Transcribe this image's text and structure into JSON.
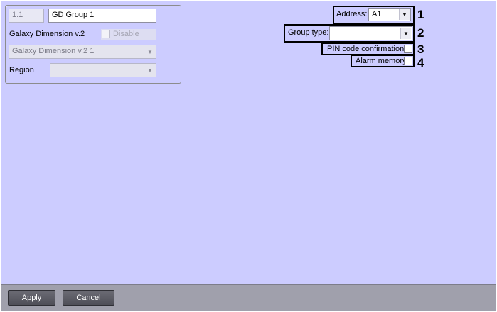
{
  "group": {
    "number": "1.1",
    "name": "GD Group 1",
    "parent_label": "Galaxy Dimension v.2",
    "disable_label": "Disable",
    "parent_select": "Galaxy Dimension v.2 1",
    "region_label": "Region",
    "region_value": ""
  },
  "settings": {
    "address_label": "Address:",
    "address_value": "A1",
    "group_type_label": "Group type:",
    "group_type_value": "",
    "pin_label": "PIN code confirmation",
    "alarm_label": "Alarm memory"
  },
  "callouts": [
    "1",
    "2",
    "3",
    "4"
  ],
  "buttons": {
    "apply": "Apply",
    "cancel": "Cancel"
  },
  "icons": {
    "dropdown": "chevron-down-icon"
  }
}
